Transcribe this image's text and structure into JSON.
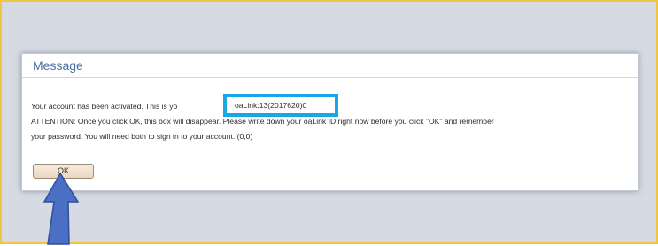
{
  "dialog": {
    "title": "Message",
    "line1_before": "Your account has been activated. This is yo",
    "line1_after": "",
    "line2": "ATTENTION: Once you click OK, this box will disappear. Please write down your oaLink ID right now before you click \"OK\" and remember",
    "line3": "your password. You will need both to sign in to your account. (0,0)",
    "highlighted_id": "oaLink:13(2017620)0",
    "ok_label": "OK"
  },
  "colors": {
    "frame_border": "#f0c640",
    "highlight_border": "#18a7e4",
    "arrow": "#4a6fc4",
    "title_text": "#4a6fa1"
  },
  "annotation": {
    "arrow_icon": "arrow-up-icon"
  }
}
